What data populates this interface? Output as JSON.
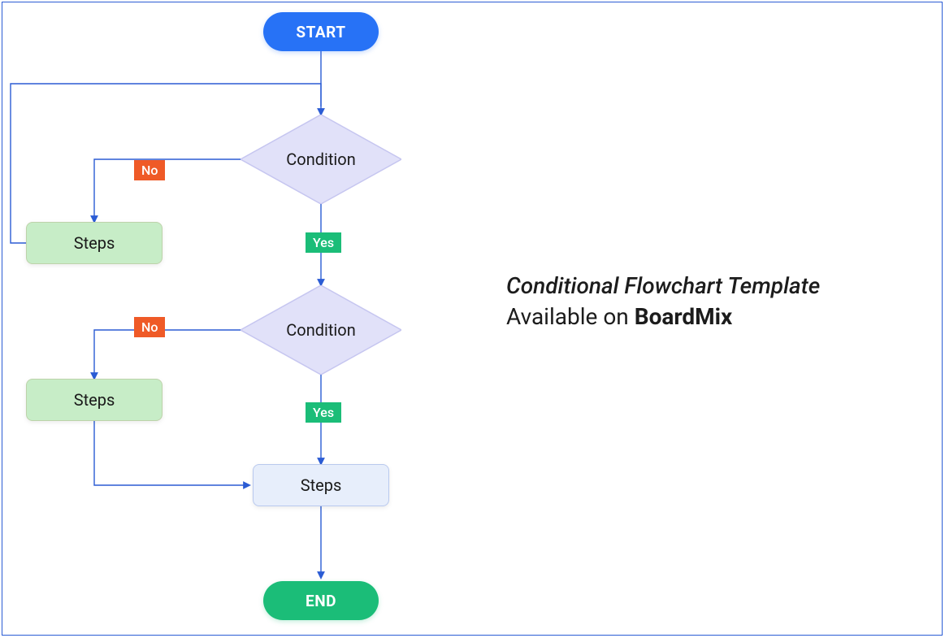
{
  "flow": {
    "start": "START",
    "end": "END",
    "decision1": "Condition",
    "decision2": "Condition",
    "steps1": "Steps",
    "steps2": "Steps",
    "steps3": "Steps",
    "yes": "Yes",
    "no": "No"
  },
  "caption": {
    "title": "Conditional Flowchart Template",
    "prefix": "Available on ",
    "brand": "BoardMix"
  },
  "colors": {
    "start": "#2772f6",
    "end": "#1bbd78",
    "decision_fill": "#e1e1f9",
    "decision_stroke": "#c6c6f0",
    "process_green": "#c7edc7",
    "process_blue": "#e7eefb",
    "no_badge": "#ef5a27",
    "yes_badge": "#1bbd78",
    "connector": "#2b5cd4"
  }
}
